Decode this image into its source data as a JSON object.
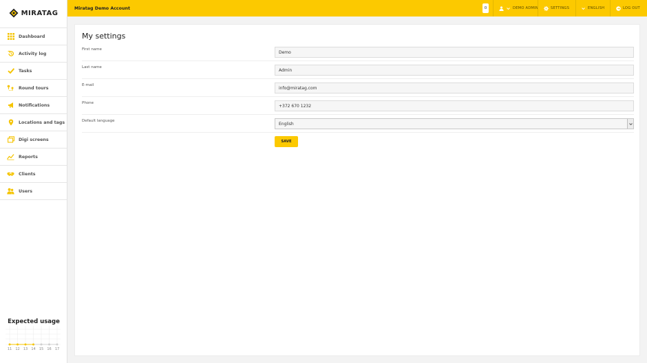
{
  "brand": {
    "name": "MIRATAG",
    "accent": "#fcc900"
  },
  "sidebar": {
    "items": [
      {
        "label": "Dashboard",
        "icon": "grid-icon"
      },
      {
        "label": "Activity log",
        "icon": "history-icon"
      },
      {
        "label": "Tasks",
        "icon": "check-icon"
      },
      {
        "label": "Round tours",
        "icon": "route-icon"
      },
      {
        "label": "Notifications",
        "icon": "megaphone-icon"
      },
      {
        "label": "Locations and tags",
        "icon": "pin-icon"
      },
      {
        "label": "Digi screens",
        "icon": "screens-icon"
      },
      {
        "label": "Reports",
        "icon": "chart-icon"
      },
      {
        "label": "Clients",
        "icon": "handshake-icon"
      },
      {
        "label": "Users",
        "icon": "users-icon"
      }
    ],
    "usage": {
      "title": "Expected usage",
      "days": [
        "11",
        "12",
        "13",
        "14",
        "15",
        "16",
        "17"
      ]
    }
  },
  "header": {
    "account": "Miratag Demo Account",
    "notifications_count": "0",
    "user": "DEMO ADMIN",
    "settings": "SETTINGS",
    "language": "ENGLISH",
    "logout": "LOG OUT"
  },
  "main": {
    "title": "My settings",
    "fields": [
      {
        "label": "First name",
        "value": "Demo"
      },
      {
        "label": "Last name",
        "value": "Admin"
      },
      {
        "label": "E-mail",
        "value": "info@miratag.com"
      },
      {
        "label": "Phone",
        "value": "+372 670 1232"
      }
    ],
    "language_field": {
      "label": "Default language",
      "value": "English"
    },
    "save_label": "SAVE"
  }
}
